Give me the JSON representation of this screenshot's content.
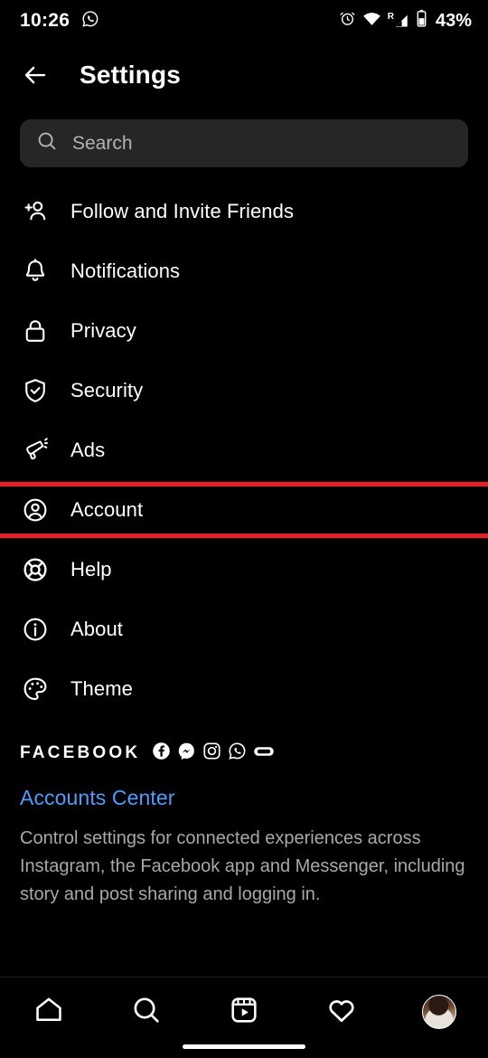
{
  "statusbar": {
    "time": "10:26",
    "whatsapp_icon": "whatsapp-icon",
    "alarm_icon": "alarm-icon",
    "wifi_icon": "wifi-icon",
    "signal_icon": "signal-roaming-icon",
    "roaming_label": "R",
    "battery_icon": "battery-icon",
    "battery_percent": "43%"
  },
  "header": {
    "back_icon": "back-arrow-icon",
    "title": "Settings"
  },
  "search": {
    "icon": "search-icon",
    "placeholder": "Search",
    "value": ""
  },
  "menu": {
    "items": [
      {
        "label": "Follow and Invite Friends",
        "icon": "person-add-icon",
        "highlighted": false
      },
      {
        "label": "Notifications",
        "icon": "bell-icon",
        "highlighted": false
      },
      {
        "label": "Privacy",
        "icon": "lock-icon",
        "highlighted": false
      },
      {
        "label": "Security",
        "icon": "shield-check-icon",
        "highlighted": false
      },
      {
        "label": "Ads",
        "icon": "megaphone-icon",
        "highlighted": false
      },
      {
        "label": "Account",
        "icon": "person-circle-icon",
        "highlighted": true
      },
      {
        "label": "Help",
        "icon": "life-ring-icon",
        "highlighted": false
      },
      {
        "label": "About",
        "icon": "info-circle-icon",
        "highlighted": false
      },
      {
        "label": "Theme",
        "icon": "palette-icon",
        "highlighted": false
      }
    ]
  },
  "facebook_section": {
    "brand": "FACEBOOK",
    "brand_icons": [
      "facebook-icon",
      "messenger-icon",
      "instagram-icon",
      "whatsapp-icon",
      "oculus-icon"
    ],
    "link_label": "Accounts Center",
    "description": "Control settings for connected experiences across Instagram, the Facebook app and Messenger, including story and post sharing and logging in."
  },
  "bottom_nav": {
    "items": [
      {
        "icon": "home-icon",
        "name": "nav-home"
      },
      {
        "icon": "search-icon",
        "name": "nav-search"
      },
      {
        "icon": "reels-icon",
        "name": "nav-reels"
      },
      {
        "icon": "heart-icon",
        "name": "nav-activity"
      },
      {
        "icon": "avatar-icon",
        "name": "nav-profile"
      }
    ]
  },
  "colors": {
    "background": "#000000",
    "search_field": "#262626",
    "link_blue": "#4a9eff",
    "muted_text": "#a8a8a8",
    "highlight_red": "#ED1C24"
  }
}
